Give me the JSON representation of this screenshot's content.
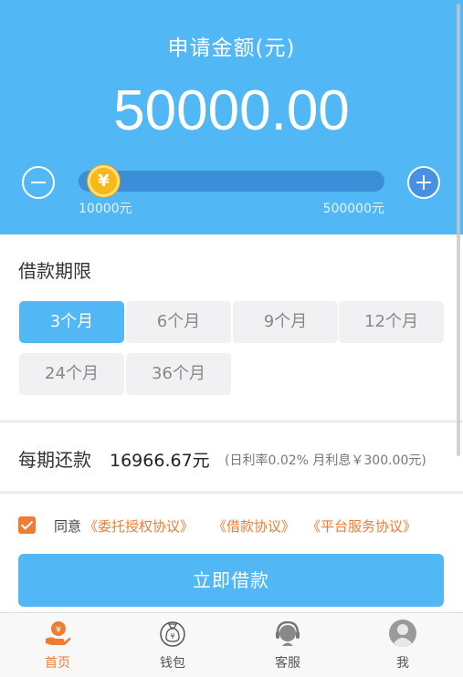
{
  "header": {
    "label": "申请金额(元)",
    "amount": "50000.00",
    "slider": {
      "min_label": "10000元",
      "max_label": "500000元",
      "min": 10000,
      "max": 500000,
      "value": 50000,
      "thumb_symbol": "¥"
    }
  },
  "term": {
    "title": "借款期限",
    "options": [
      "3个月",
      "6个月",
      "9个月",
      "12个月",
      "24个月",
      "36个月"
    ],
    "selected": "3个月"
  },
  "repayment": {
    "label": "每期还款",
    "value": "16966.67元",
    "note": "(日利率0.02%  月利息￥300.00元)"
  },
  "agreement": {
    "checked": true,
    "prefix": "同意",
    "links": [
      "《委托授权协议》",
      "《借款协议》",
      "《平台服务协议》"
    ]
  },
  "submit_label": "立即借款",
  "tabbar": {
    "active": "首页",
    "items": [
      {
        "label": "首页",
        "icon": "home-hand-yen-icon"
      },
      {
        "label": "钱包",
        "icon": "wallet-bag-icon"
      },
      {
        "label": "客服",
        "icon": "customer-service-icon"
      },
      {
        "label": "我",
        "icon": "user-profile-icon"
      }
    ]
  },
  "colors": {
    "primary_blue": "#52b8f5",
    "accent_orange": "#ef7d31",
    "slider_track": "#3a8fd8"
  }
}
